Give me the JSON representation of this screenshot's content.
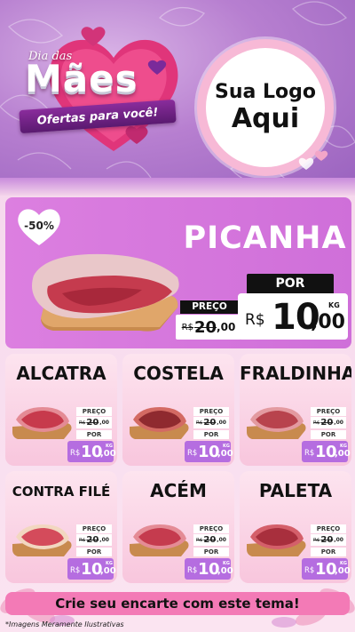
{
  "header": {
    "dia_das": "Dia das",
    "title": "Mães",
    "subtitle": "Ofertas para você!",
    "logo_line1": "Sua Logo",
    "logo_line2": "Aqui"
  },
  "featured": {
    "name": "PICANHA",
    "discount": "-50%",
    "preco_label": "PREÇO",
    "por_label": "POR",
    "old_currency": "R$",
    "old_amount": "20",
    "old_cents": ",00",
    "new_currency": "R$",
    "new_amount": "10",
    "new_cents": ",00",
    "unit": "KG"
  },
  "products": [
    {
      "name": "ALCATRA",
      "preco_label": "PREÇO",
      "old_currency": "R$",
      "old_amount": "20",
      "old_cents": ",00",
      "por_label": "POR",
      "new_currency": "R$",
      "new_amount": "10",
      "new_cents": ",00",
      "unit": "KG"
    },
    {
      "name": "COSTELA",
      "preco_label": "PREÇO",
      "old_currency": "R$",
      "old_amount": "20",
      "old_cents": ",00",
      "por_label": "POR",
      "new_currency": "R$",
      "new_amount": "10",
      "new_cents": ",00",
      "unit": "KG"
    },
    {
      "name": "FRALDINHA",
      "preco_label": "PREÇO",
      "old_currency": "R$",
      "old_amount": "20",
      "old_cents": ",00",
      "por_label": "POR",
      "new_currency": "R$",
      "new_amount": "10",
      "new_cents": ",00",
      "unit": "KG"
    },
    {
      "name": "CONTRA FILÉ",
      "preco_label": "PREÇO",
      "old_currency": "R$",
      "old_amount": "20",
      "old_cents": ",00",
      "por_label": "POR",
      "new_currency": "R$",
      "new_amount": "10",
      "new_cents": ",00",
      "unit": "KG"
    },
    {
      "name": "ACÉM",
      "preco_label": "PREÇO",
      "old_currency": "R$",
      "old_amount": "20",
      "old_cents": ",00",
      "por_label": "POR",
      "new_currency": "R$",
      "new_amount": "10",
      "new_cents": ",00",
      "unit": "KG"
    },
    {
      "name": "PALETA",
      "preco_label": "PREÇO",
      "old_currency": "R$",
      "old_amount": "20",
      "old_cents": ",00",
      "por_label": "POR",
      "new_currency": "R$",
      "new_amount": "10",
      "new_cents": ",00",
      "unit": "KG"
    }
  ],
  "footer": {
    "cta": "Crie seu encarte com este tema!",
    "disclaimer": "*Imagens Meramente Ilustrativas"
  },
  "colors": {
    "accent_purple": "#b56de0",
    "featured_bg": "#d574dc",
    "cta_pink": "#f37ab6"
  },
  "icons": [
    "heart-icon",
    "meat-icon",
    "cutting-board-icon",
    "flower-icon"
  ]
}
